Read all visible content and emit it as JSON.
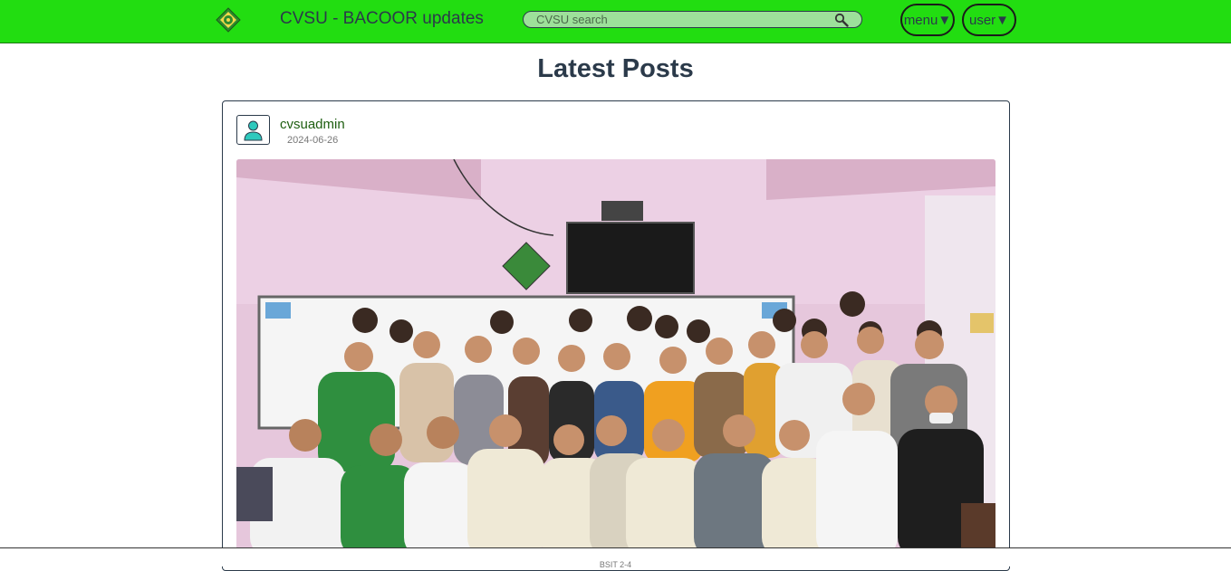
{
  "header": {
    "title": "CVSU - BACOOR updates",
    "logo_icon": "university-seal-icon",
    "search_placeholder": "CVSU search",
    "search_icon": "magnifier-icon",
    "menu_label": "menu▼",
    "user_label": "user▼"
  },
  "main": {
    "heading": "Latest Posts",
    "posts": [
      {
        "author": "cvsuadmin",
        "date": "2024-06-26",
        "avatar_icon": "user-avatar-icon",
        "image": "group-photo"
      }
    ]
  },
  "footer": {
    "text": "BSIT 2-4"
  },
  "colors": {
    "header_bg": "#22dd11",
    "text_dark": "#2b3a4a",
    "author_green": "#1e5e10",
    "avatar_teal": "#2fc9bd"
  }
}
